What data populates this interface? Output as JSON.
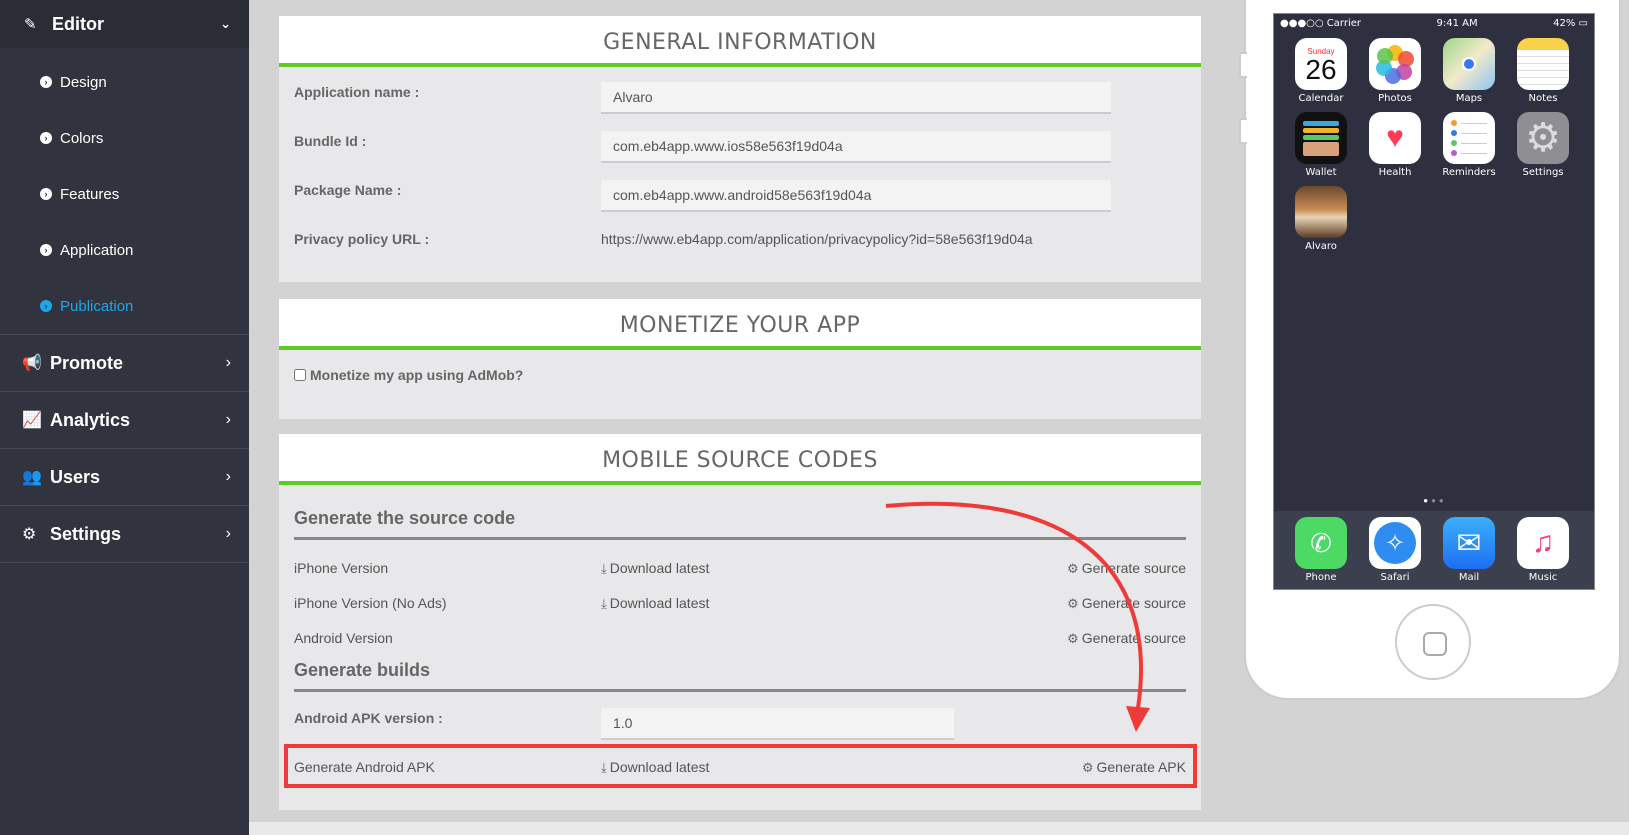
{
  "sidebar": {
    "editor_label": "Editor",
    "sub_items": [
      "Design",
      "Colors",
      "Features",
      "Application",
      "Publication"
    ],
    "active_item": "Publication",
    "main_items": [
      "Promote",
      "Analytics",
      "Users",
      "Settings"
    ]
  },
  "general": {
    "title": "GENERAL INFORMATION",
    "app_name_label": "Application name :",
    "app_name_value": "Alvaro",
    "bundle_label": "Bundle Id :",
    "bundle_value": "com.eb4app.www.ios58e563f19d04a",
    "package_label": "Package Name :",
    "package_value": "com.eb4app.www.android58e563f19d04a",
    "privacy_label": "Privacy policy URL :",
    "privacy_value": "https://www.eb4app.com/application/privacypolicy?id=58e563f19d04a"
  },
  "monetize": {
    "title": "MONETIZE YOUR APP",
    "checkbox_label": "Monetize my app using AdMob?"
  },
  "source": {
    "title": "MOBILE SOURCE CODES",
    "gen_source_heading": "Generate the source code",
    "rows": [
      {
        "name": "iPhone Version",
        "download": "Download latest",
        "action": "Generate source"
      },
      {
        "name": "iPhone Version (No Ads)",
        "download": "Download latest",
        "action": "Generate source"
      },
      {
        "name": "Android Version",
        "download": "",
        "action": "Generate source"
      }
    ],
    "gen_builds_heading": "Generate builds",
    "apk_version_label": "Android APK version :",
    "apk_version_value": "1.0",
    "apk_row_name": "Generate Android APK",
    "apk_download": "Download latest",
    "apk_action": "Generate APK"
  },
  "phone": {
    "carrier": "●●●○○ Carrier",
    "time": "9:41 AM",
    "battery": "42%",
    "calendar_day": "Sunday",
    "calendar_date": "26",
    "apps": [
      "Calendar",
      "Photos",
      "Maps",
      "Notes",
      "Wallet",
      "Health",
      "Reminders",
      "Settings",
      "Alvaro"
    ],
    "dock": [
      "Phone",
      "Safari",
      "Mail",
      "Music"
    ]
  },
  "colors": {
    "accent_green": "#5ecb22",
    "highlight_red": "#ef3a3a",
    "active_blue": "#1ea7e8"
  }
}
